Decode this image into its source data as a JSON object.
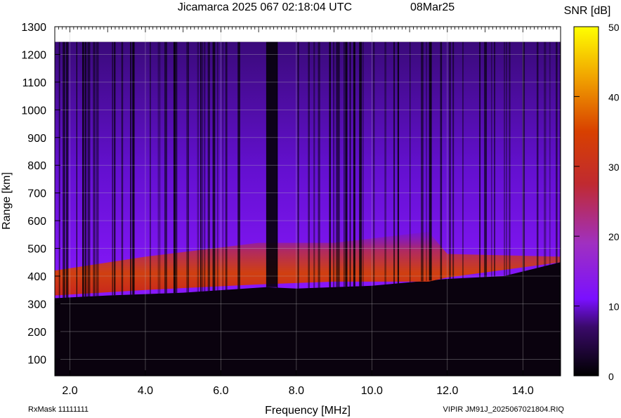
{
  "chart_data": {
    "type": "heatmap",
    "title": "Jicamarca 2025 067 02:18:04 UTC",
    "date_label": "08Mar25",
    "xlabel": "Frequency [MHz]",
    "ylabel": "Range [km]",
    "xlim": [
      1.6,
      15.0
    ],
    "ylim": [
      40,
      1300
    ],
    "x_ticks": [
      "2.0",
      "4.0",
      "6.0",
      "8.0",
      "10.0",
      "12.0",
      "14.0"
    ],
    "y_ticks": [
      "100",
      "200",
      "300",
      "400",
      "500",
      "600",
      "700",
      "800",
      "900",
      "1000",
      "1100",
      "1200",
      "1300"
    ],
    "colorbar": {
      "label": "SNR [dB]",
      "range": [
        0,
        50
      ],
      "ticks": [
        "0",
        "10",
        "20",
        "30",
        "40",
        "50"
      ],
      "colors": [
        "#000000",
        "#3a0a6a",
        "#7a10ff",
        "#a030c0",
        "#c02a30",
        "#d84000",
        "#f0a000",
        "#ffff00"
      ]
    },
    "grid": true,
    "data_top_km": 1245,
    "virtual_height_trace": [
      {
        "f": 1.6,
        "h": 320
      },
      {
        "f": 3.0,
        "h": 330
      },
      {
        "f": 5.0,
        "h": 340
      },
      {
        "f": 7.2,
        "h": 360
      },
      {
        "f": 8.0,
        "h": 355
      },
      {
        "f": 10.0,
        "h": 365
      },
      {
        "f": 12.0,
        "h": 390
      },
      {
        "f": 13.5,
        "h": 400
      },
      {
        "f": 15.0,
        "h": 450
      }
    ],
    "strong_echo_band": [
      {
        "f": 1.6,
        "h0": 330,
        "h1": 420
      },
      {
        "f": 4.0,
        "h0": 350,
        "h1": 470
      },
      {
        "f": 7.0,
        "h0": 370,
        "h1": 520
      },
      {
        "f": 9.0,
        "h0": 380,
        "h1": 520
      },
      {
        "f": 11.5,
        "h0": 380,
        "h1": 560
      },
      {
        "f": 12.0,
        "h0": 395,
        "h1": 480
      },
      {
        "f": 15.0,
        "h0": 450,
        "h1": 470
      }
    ]
  },
  "footer": {
    "rxmask": "RxMask 11111111",
    "file_label": "VIPIR  JM91J_2025067021804.RIQ"
  }
}
